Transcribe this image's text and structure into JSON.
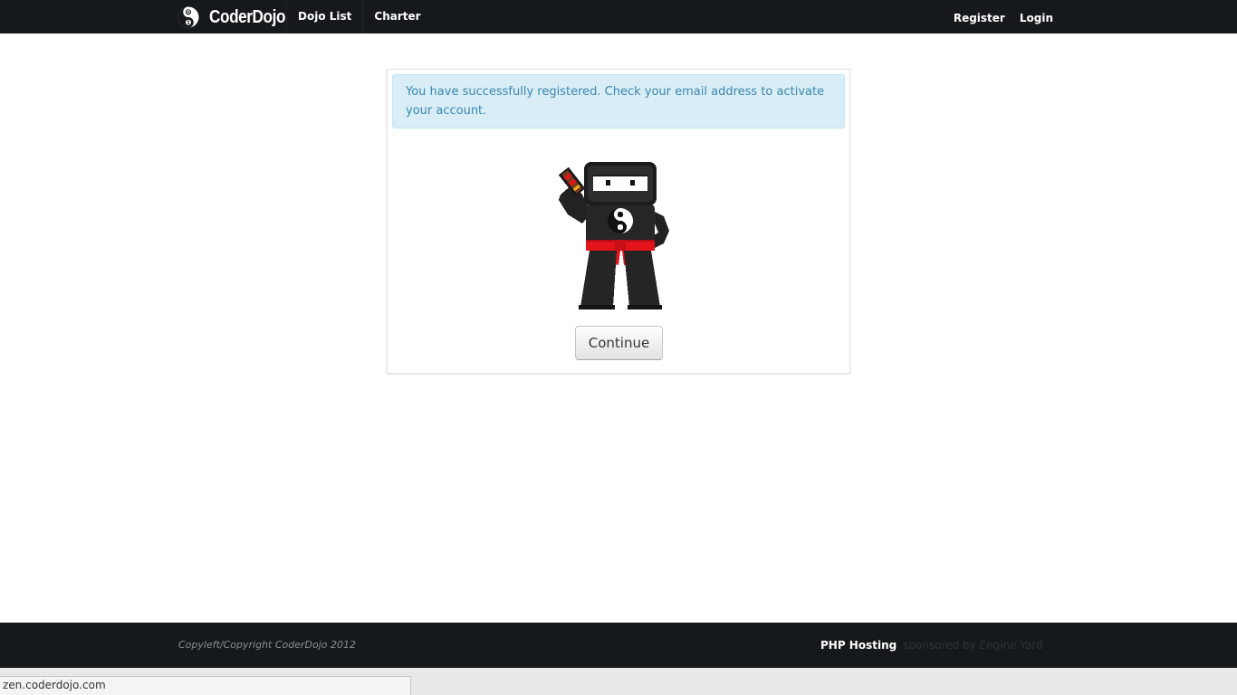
{
  "header": {
    "brand_name": "CoderDojo",
    "logo_glyphs": {
      "top": "0",
      "bottom": "1"
    },
    "nav_left": [
      {
        "label": "Dojo List"
      },
      {
        "label": "Charter"
      }
    ],
    "nav_right": [
      {
        "label": "Register"
      },
      {
        "label": "Login"
      }
    ]
  },
  "main": {
    "alert_text": "You have successfully registered. Check your email address to activate your account.",
    "mascot_icon": "ninja-mascot",
    "continue_label": "Continue"
  },
  "footer": {
    "copyright": "Copyleft/Copyright CoderDojo 2012",
    "hosting_label": "PHP Hosting",
    "sponsor_text": "sponsored by Engine Yard"
  },
  "status_bar": {
    "url": "zen.coderdojo.com"
  },
  "colors": {
    "nav_bg": "#15191b",
    "alert_bg": "#d9edf7",
    "alert_text": "#3a87ad",
    "belt_red": "#e3141b"
  }
}
